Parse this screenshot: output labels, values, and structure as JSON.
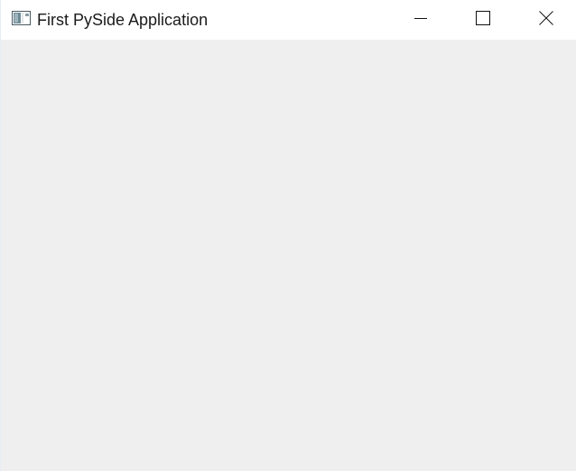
{
  "window": {
    "title": "First PySide Application",
    "icon": "application-window-icon",
    "controls": {
      "minimize": "minimize-icon",
      "maximize": "maximize-icon",
      "close": "close-icon"
    },
    "colors": {
      "titlebar": "#ffffff",
      "client_area": "#efefef",
      "title_text": "#1a1a1a"
    }
  }
}
